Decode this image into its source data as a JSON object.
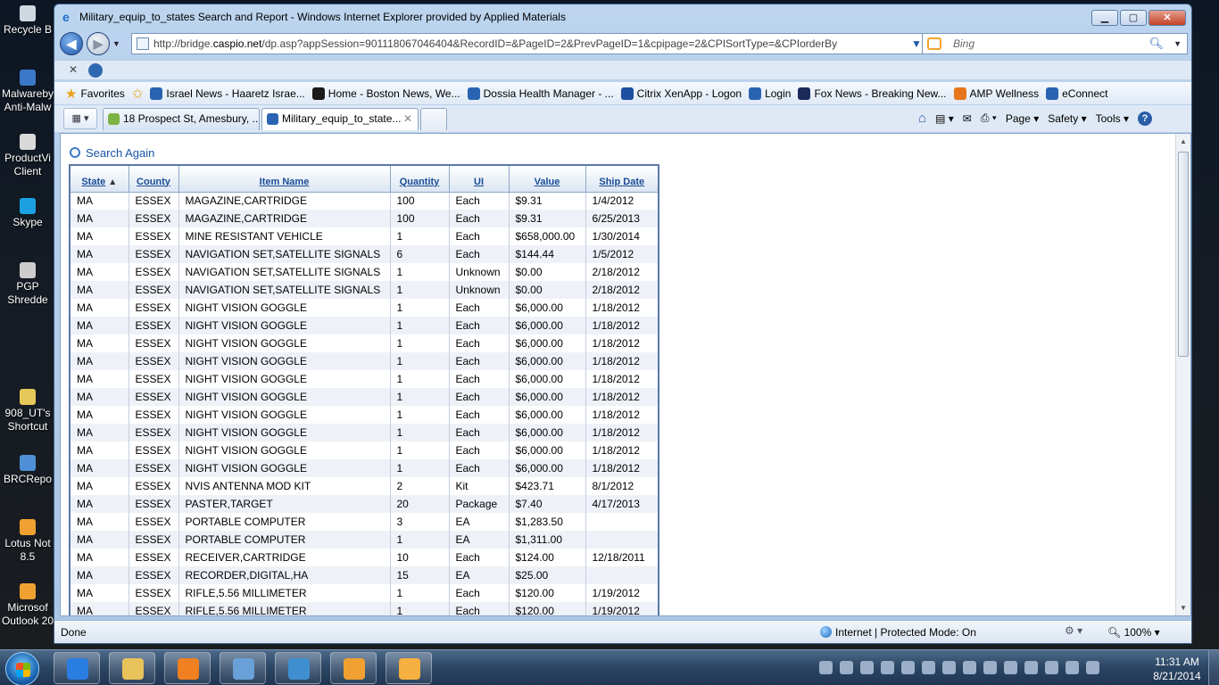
{
  "desktop_icons": [
    {
      "label": "Recycle B",
      "color": "#cfd8e0"
    },
    {
      "label": "Malwareby",
      "label2": "Anti-Malw",
      "color": "#3a78c8"
    },
    {
      "label": "ProductVi",
      "label2": "Client",
      "color": "#d9d9d9"
    },
    {
      "label": "Skype",
      "color": "#1ba1e2"
    },
    {
      "label": "PGP",
      "label2": "Shredde",
      "color": "#cccccc"
    },
    {
      "label": "908_UT's",
      "label2": "Shortcut",
      "color": "#e6c75a"
    },
    {
      "label": "BRCRepo",
      "color": "#4f8fd6"
    },
    {
      "label": "Lotus Not",
      "label2": "8.5",
      "color": "#f0a030"
    },
    {
      "label": "Microsof",
      "label2": "Outlook 20",
      "color": "#f0a030"
    }
  ],
  "window": {
    "title": "Military_equip_to_states Search and Report - Windows Internet Explorer provided by Applied Materials",
    "controls": {
      "minimize": "▁",
      "maximize": "▢",
      "close": "✕"
    }
  },
  "address": {
    "prefix": "http://bridge.",
    "domain": "caspio.net",
    "rest": "/dp.asp?appSession=901118067046404&RecordID=&PageID=2&PrevPageID=1&cpipage=2&CPISortType=&CPIorderBy"
  },
  "search": {
    "placeholder": "Bing"
  },
  "favorites": {
    "label": "Favorites",
    "items": [
      {
        "label": "Israel News - Haaretz Israe...",
        "color": "#2b63b3"
      },
      {
        "label": "Home - Boston News, We...",
        "color": "#1a1a1a"
      },
      {
        "label": "Dossia Health Manager - ...",
        "color": "#2b63b3"
      },
      {
        "label": "Citrix XenApp - Logon",
        "color": "#1f4fa0"
      },
      {
        "label": "Login",
        "color": "#2b63b3"
      },
      {
        "label": "Fox News - Breaking New...",
        "color": "#1a2a5a"
      },
      {
        "label": "AMP Wellness",
        "color": "#e8761c"
      },
      {
        "label": "eConnect",
        "color": "#2b63b3"
      }
    ]
  },
  "tabs": [
    {
      "label": "18 Prospect St, Amesbury, ..."
    },
    {
      "label": "Military_equip_to_state..."
    }
  ],
  "command_bar": {
    "page": "Page ▾",
    "safety": "Safety ▾",
    "tools": "Tools ▾"
  },
  "page": {
    "search_again": "Search Again",
    "columns": [
      "State",
      "County",
      "Item Name",
      "Quantity",
      "UI",
      "Value",
      "Ship Date"
    ],
    "rows": [
      [
        "MA",
        "ESSEX",
        "MAGAZINE,CARTRIDGE",
        "100",
        "Each",
        "$9.31",
        "1/4/2012"
      ],
      [
        "MA",
        "ESSEX",
        "MAGAZINE,CARTRIDGE",
        "100",
        "Each",
        "$9.31",
        "6/25/2013"
      ],
      [
        "MA",
        "ESSEX",
        "MINE RESISTANT VEHICLE",
        "1",
        "Each",
        "$658,000.00",
        "1/30/2014"
      ],
      [
        "MA",
        "ESSEX",
        "NAVIGATION SET,SATELLITE SIGNALS",
        "6",
        "Each",
        "$144.44",
        "1/5/2012"
      ],
      [
        "MA",
        "ESSEX",
        "NAVIGATION SET,SATELLITE SIGNALS",
        "1",
        "Unknown",
        "$0.00",
        "2/18/2012"
      ],
      [
        "MA",
        "ESSEX",
        "NAVIGATION SET,SATELLITE SIGNALS",
        "1",
        "Unknown",
        "$0.00",
        "2/18/2012"
      ],
      [
        "MA",
        "ESSEX",
        "NIGHT VISION GOGGLE",
        "1",
        "Each",
        "$6,000.00",
        "1/18/2012"
      ],
      [
        "MA",
        "ESSEX",
        "NIGHT VISION GOGGLE",
        "1",
        "Each",
        "$6,000.00",
        "1/18/2012"
      ],
      [
        "MA",
        "ESSEX",
        "NIGHT VISION GOGGLE",
        "1",
        "Each",
        "$6,000.00",
        "1/18/2012"
      ],
      [
        "MA",
        "ESSEX",
        "NIGHT VISION GOGGLE",
        "1",
        "Each",
        "$6,000.00",
        "1/18/2012"
      ],
      [
        "MA",
        "ESSEX",
        "NIGHT VISION GOGGLE",
        "1",
        "Each",
        "$6,000.00",
        "1/18/2012"
      ],
      [
        "MA",
        "ESSEX",
        "NIGHT VISION GOGGLE",
        "1",
        "Each",
        "$6,000.00",
        "1/18/2012"
      ],
      [
        "MA",
        "ESSEX",
        "NIGHT VISION GOGGLE",
        "1",
        "Each",
        "$6,000.00",
        "1/18/2012"
      ],
      [
        "MA",
        "ESSEX",
        "NIGHT VISION GOGGLE",
        "1",
        "Each",
        "$6,000.00",
        "1/18/2012"
      ],
      [
        "MA",
        "ESSEX",
        "NIGHT VISION GOGGLE",
        "1",
        "Each",
        "$6,000.00",
        "1/18/2012"
      ],
      [
        "MA",
        "ESSEX",
        "NIGHT VISION GOGGLE",
        "1",
        "Each",
        "$6,000.00",
        "1/18/2012"
      ],
      [
        "MA",
        "ESSEX",
        "NVIS ANTENNA MOD KIT",
        "2",
        "Kit",
        "$423.71",
        "8/1/2012"
      ],
      [
        "MA",
        "ESSEX",
        "PASTER,TARGET",
        "20",
        "Package",
        "$7.40",
        "4/17/2013"
      ],
      [
        "MA",
        "ESSEX",
        "PORTABLE COMPUTER",
        "3",
        "EA",
        "$1,283.50",
        ""
      ],
      [
        "MA",
        "ESSEX",
        "PORTABLE COMPUTER",
        "1",
        "EA",
        "$1,311.00",
        ""
      ],
      [
        "MA",
        "ESSEX",
        "RECEIVER,CARTRIDGE",
        "10",
        "Each",
        "$124.00",
        "12/18/2011"
      ],
      [
        "MA",
        "ESSEX",
        "RECORDER,DIGITAL,HA",
        "15",
        "EA",
        "$25.00",
        ""
      ],
      [
        "MA",
        "ESSEX",
        "RIFLE,5.56 MILLIMETER",
        "1",
        "Each",
        "$120.00",
        "1/19/2012"
      ],
      [
        "MA",
        "ESSEX",
        "RIFLE,5.56 MILLIMETER",
        "1",
        "Each",
        "$120.00",
        "1/19/2012"
      ]
    ]
  },
  "status": {
    "left": "Done",
    "zone": "Internet | Protected Mode: On",
    "zoom": "100%"
  },
  "taskbar": {
    "buttons": [
      {
        "name": "internet-explorer",
        "color": "#2a7de1"
      },
      {
        "name": "windows-explorer",
        "color": "#e8c25a"
      },
      {
        "name": "media-player",
        "color": "#f08020"
      },
      {
        "name": "snipping-camera",
        "color": "#6aa0d8"
      },
      {
        "name": "lync",
        "color": "#3f8fd0"
      },
      {
        "name": "lotus-notes",
        "color": "#f0a030"
      },
      {
        "name": "outlook",
        "color": "#f5b041"
      }
    ],
    "time": "11:31 AM",
    "date": "8/21/2014"
  }
}
